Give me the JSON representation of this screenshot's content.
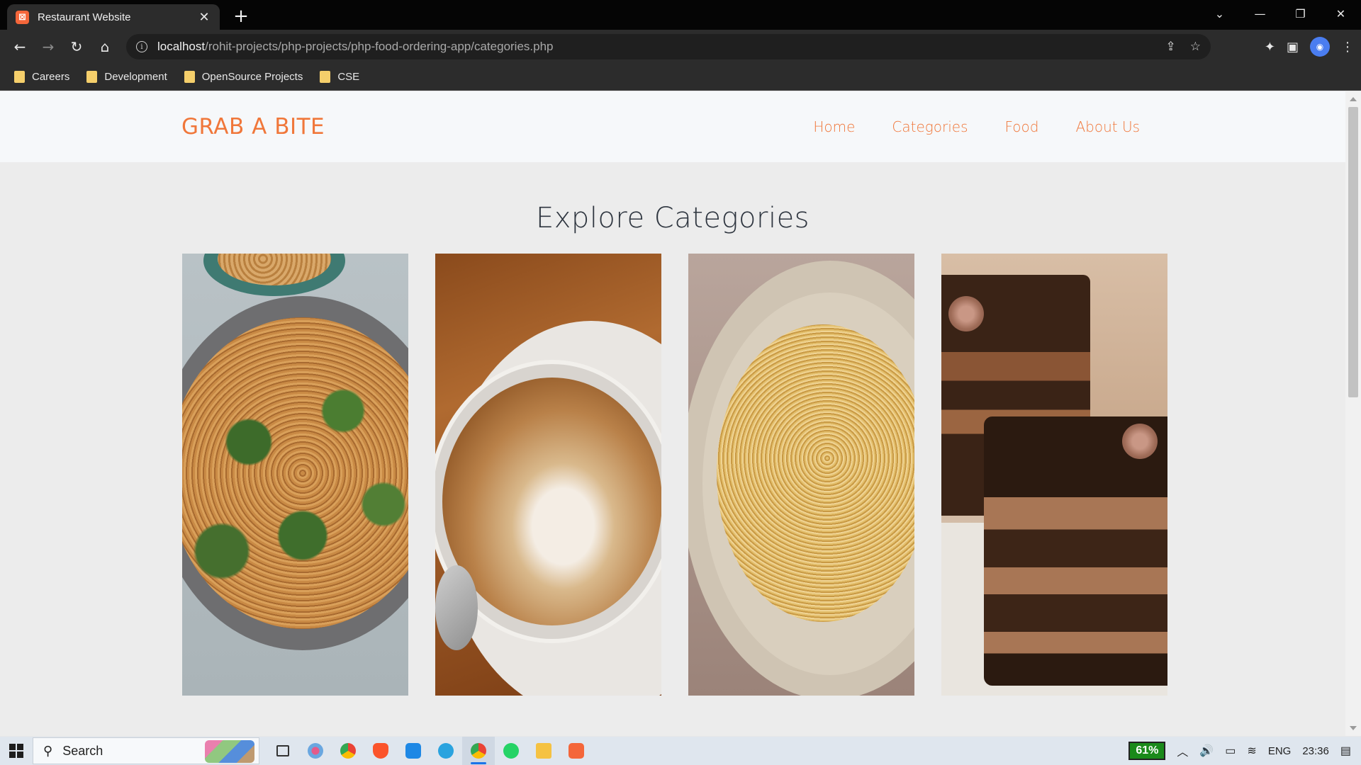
{
  "browser": {
    "tab_title": "Restaurant Website",
    "tab_close": "✕",
    "new_tab": "+",
    "url_host": "localhost",
    "url_path": "/rohit-projects/php-projects/php-food-ordering-app/categories.php",
    "window_controls": [
      "⌄",
      "—",
      "❐",
      "✕"
    ],
    "bookmarks": [
      {
        "label": "Careers"
      },
      {
        "label": "Development"
      },
      {
        "label": "OpenSource Projects"
      },
      {
        "label": "CSE"
      }
    ]
  },
  "site": {
    "brand": "GRAB A BITE",
    "nav": [
      {
        "label": "Home"
      },
      {
        "label": "Categories"
      },
      {
        "label": "Food"
      },
      {
        "label": "About Us"
      }
    ],
    "section_title": "Explore Categories",
    "categories": [
      {
        "icon": "noodles-image"
      },
      {
        "icon": "coffee-image"
      },
      {
        "icon": "pasta-image"
      },
      {
        "icon": "cake-image"
      }
    ]
  },
  "taskbar": {
    "search_label": "Search",
    "battery": "61%",
    "language": "ENG",
    "time": "23:36"
  },
  "colors": {
    "accent": "#f0773a",
    "page_bg": "#ececec",
    "header_bg": "#f6f8fa"
  }
}
